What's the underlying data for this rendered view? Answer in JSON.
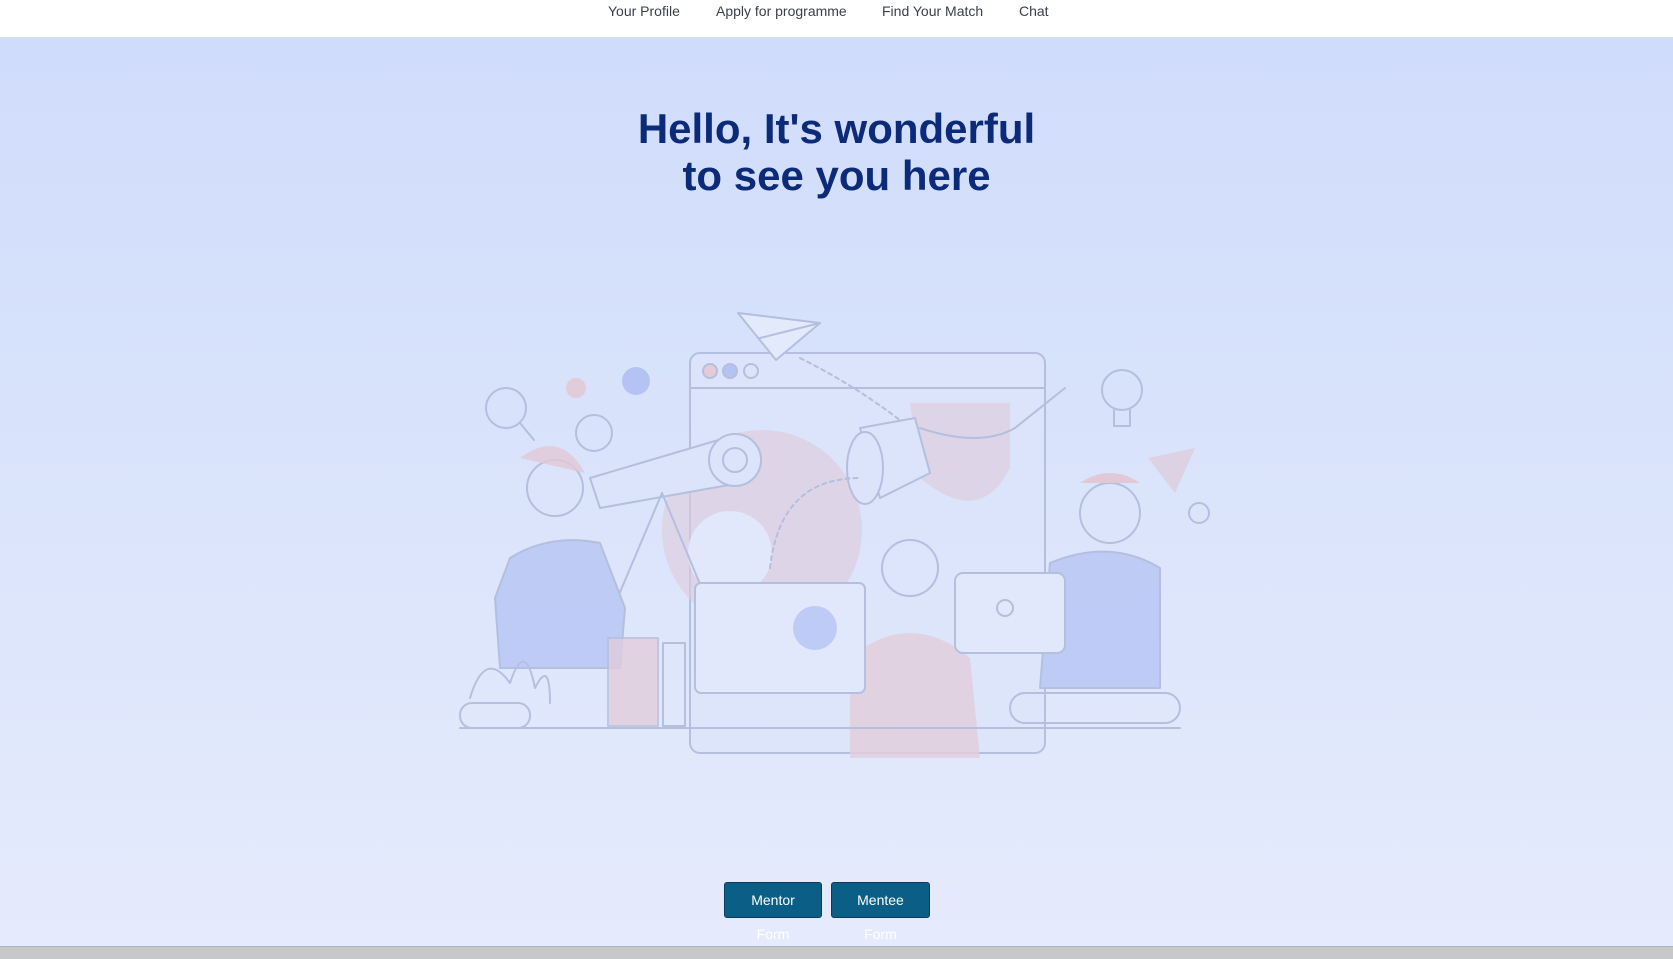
{
  "nav": {
    "items": [
      {
        "label": "Your Profile"
      },
      {
        "label": "Apply for programme"
      },
      {
        "label": "Find Your Match"
      },
      {
        "label": "Chat"
      }
    ]
  },
  "hero": {
    "title_line1": "Hello, It's wonderful",
    "title_line2": "to see you here",
    "illustration_icon": "team-collaboration-illustration"
  },
  "actions": {
    "mentor_label": "Mentor Form",
    "mentee_label": "Mentee Form"
  },
  "colors": {
    "title": "#0b2a78",
    "button": "#0b5f86",
    "hero_bg_top": "#d0dcfb",
    "hero_bg_bottom": "#e5ebfc"
  }
}
